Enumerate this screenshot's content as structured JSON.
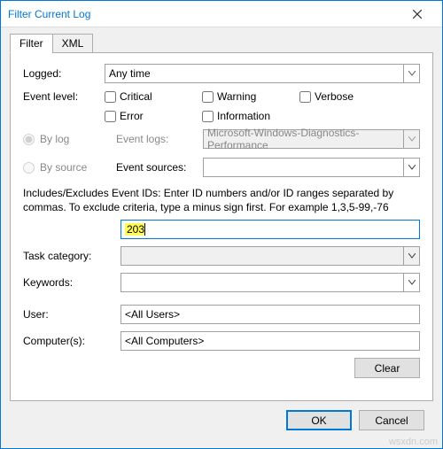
{
  "window": {
    "title": "Filter Current Log"
  },
  "tabs": {
    "filter": "Filter",
    "xml": "XML"
  },
  "labels": {
    "logged": "Logged:",
    "event_level": "Event level:",
    "by_log": "By log",
    "by_source": "By source",
    "event_logs": "Event logs:",
    "event_sources": "Event sources:",
    "task_category": "Task category:",
    "keywords": "Keywords:",
    "user": "User:",
    "computers": "Computer(s):"
  },
  "logged_select": {
    "value": "Any time"
  },
  "event_level": {
    "critical": "Critical",
    "warning": "Warning",
    "verbose": "Verbose",
    "error": "Error",
    "information": "Information"
  },
  "event_logs": {
    "value": "Microsoft-Windows-Diagnostics-Performance"
  },
  "event_sources": {
    "value": ""
  },
  "hint": "Includes/Excludes Event IDs: Enter ID numbers and/or ID ranges separated by commas. To exclude criteria, type a minus sign first. For example 1,3,5-99,-76",
  "event_id": {
    "value": "203"
  },
  "task_category": {
    "value": ""
  },
  "keywords_field": {
    "value": ""
  },
  "user": {
    "value": "<All Users>"
  },
  "computers": {
    "value": "<All Computers>"
  },
  "buttons": {
    "clear": "Clear",
    "ok": "OK",
    "cancel": "Cancel"
  },
  "watermark": "wsxdn.com"
}
